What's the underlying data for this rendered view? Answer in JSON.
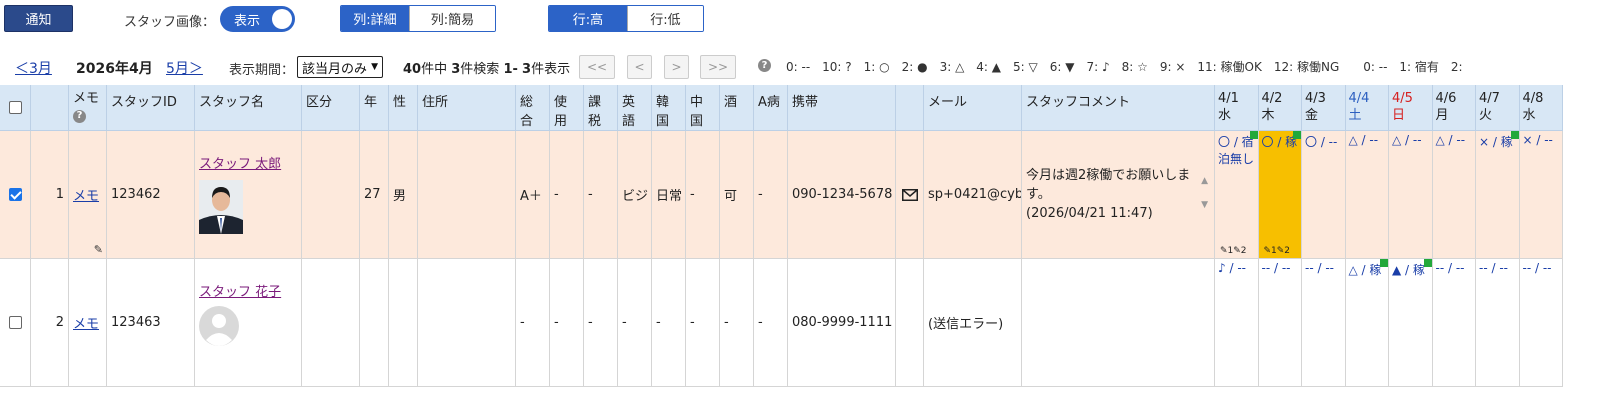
{
  "toolbar": {
    "notify_label": "通知",
    "staff_image_label": "スタッフ画像：",
    "staff_image_toggle": "表示",
    "col_detail": "列:詳細",
    "col_simple": "列:簡易",
    "row_high": "行:高",
    "row_low": "行:低"
  },
  "nav": {
    "prev_month": "＜3月",
    "current_month": "2026年4月",
    "next_month": "5月＞",
    "period_label": "表示期間：",
    "period_value": "該当月のみ",
    "count_total": "40",
    "count_total_suffix": "件中",
    "count_found": "3",
    "count_found_suffix": "件検索",
    "range_start": "1",
    "range_sep": "-",
    "range_end": "3",
    "range_suffix": "件表示",
    "first_page": "<<",
    "prev_page": "<",
    "next_page": ">",
    "last_page": ">>"
  },
  "legend": "0: --　10: ?　1: ○　2: ●　3: △　4: ▲　5: ▽　6: ▼　7: ♪　8: ☆　9: ×　11: 稼働OK　12: 稼働NG　　0: --　1: 宿有　2:",
  "headers": {
    "memo": "メモ",
    "staff_id": "スタッフID",
    "staff_name": "スタッフ名",
    "category": "区分",
    "age": "年",
    "sex": "性",
    "address": "住所",
    "overall": "総合",
    "usage": "使用",
    "tax": "課税",
    "english": "英語",
    "korean": "韓国",
    "chinese": "中国",
    "alcohol": "酒",
    "a_disease": "A病",
    "mobile": "携帯",
    "mail": "メール",
    "comment": "スタッフコメント"
  },
  "days": [
    {
      "date": "4/1",
      "dow": "水",
      "color": "#222222"
    },
    {
      "date": "4/2",
      "dow": "木",
      "color": "#222222"
    },
    {
      "date": "4/3",
      "dow": "金",
      "color": "#222222"
    },
    {
      "date": "4/4",
      "dow": "土",
      "color": "#2c5fc0"
    },
    {
      "date": "4/5",
      "dow": "日",
      "color": "#d62020"
    },
    {
      "date": "4/6",
      "dow": "月",
      "color": "#222222"
    },
    {
      "date": "4/7",
      "dow": "火",
      "color": "#222222"
    },
    {
      "date": "4/8",
      "dow": "水",
      "color": "#222222"
    }
  ],
  "rows": [
    {
      "no": "1",
      "memo": "メモ",
      "staff_id": "123462",
      "name": "スタッフ 太郎",
      "age": "27",
      "sex": "男",
      "overall": "A＋",
      "usage": "-",
      "tax": "-",
      "english": "ビジ",
      "korean": "日常",
      "chinese": "-",
      "alcohol": "可",
      "a_disease": "-",
      "mobile": "090-1234-5678",
      "mail": "sp+0421@cyb",
      "comment_line1": "今月は週2稼働でお願いしま",
      "comment_line2": "す。",
      "comment_time": "(2026/04/21 11:47)",
      "days": [
        {
          "text": "〇 / 宿",
          "sub": "泊無し",
          "note": "✎1✎2",
          "flag": true
        },
        {
          "text": "〇 / 稼",
          "sub": "",
          "note": "✎1✎2",
          "flag": true
        },
        {
          "text": "〇 / --",
          "sub": "",
          "note": "",
          "flag": false
        },
        {
          "text": "△ / --",
          "sub": "",
          "note": "",
          "flag": false
        },
        {
          "text": "△ / --",
          "sub": "",
          "note": "",
          "flag": false
        },
        {
          "text": "△ / --",
          "sub": "",
          "note": "",
          "flag": false
        },
        {
          "text": "× / 稼",
          "sub": "",
          "note": "",
          "flag": true
        },
        {
          "text": "× / --",
          "sub": "",
          "note": "",
          "flag": false
        },
        {
          "text": "-- / --",
          "sub": "",
          "note": "",
          "flag": false
        }
      ]
    },
    {
      "no": "2",
      "memo": "メモ",
      "staff_id": "123463",
      "name": "スタッフ 花子",
      "age": "",
      "sex": "",
      "overall": "-",
      "usage": "-",
      "tax": "-",
      "english": "-",
      "korean": "-",
      "chinese": "-",
      "alcohol": "-",
      "a_disease": "-",
      "mobile": "080-9999-1111",
      "mail": "(送信エラー)",
      "comment_line1": "",
      "comment_line2": "",
      "comment_time": "",
      "days": [
        {
          "text": "♪ / --",
          "flag": false
        },
        {
          "text": "-- / --",
          "flag": false
        },
        {
          "text": "-- / --",
          "flag": false
        },
        {
          "text": "△ / 稼",
          "flag": true
        },
        {
          "text": "▲ / 稼",
          "flag": true
        },
        {
          "text": "-- / --",
          "flag": false
        },
        {
          "text": "-- / --",
          "flag": false
        },
        {
          "text": "-- / --",
          "flag": false
        },
        {
          "text": "-- / --",
          "flag": false
        }
      ]
    }
  ]
}
